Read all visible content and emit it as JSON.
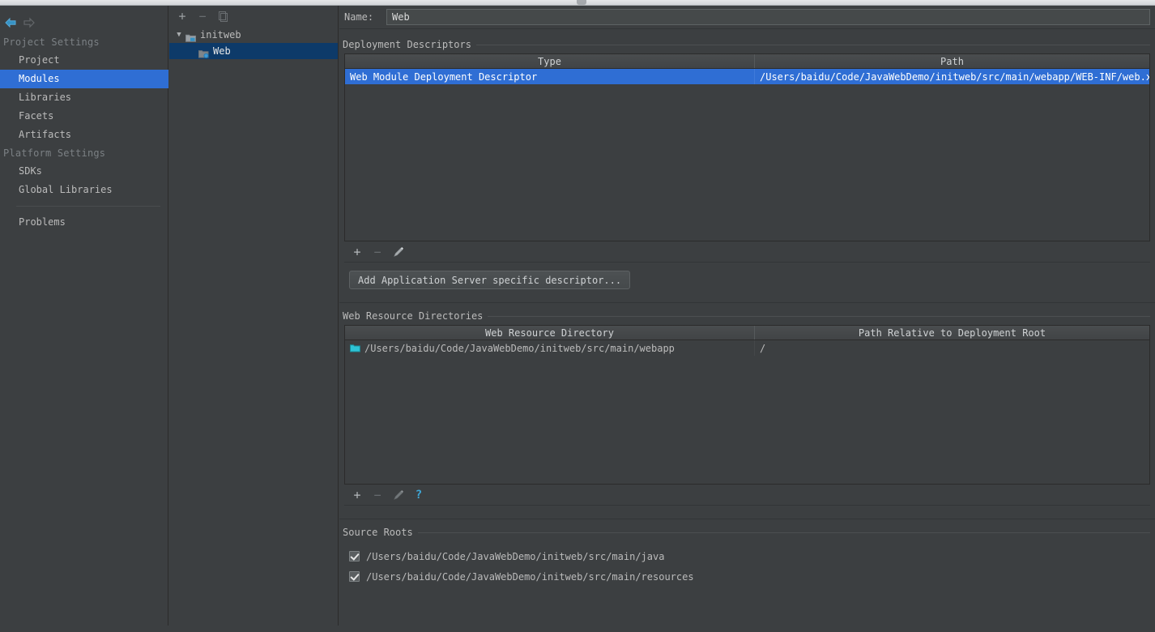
{
  "sidebar": {
    "nav": {
      "back_icon": "arrow-left-icon",
      "forward_icon": "arrow-right-icon"
    },
    "groups": [
      {
        "title": "Project Settings",
        "items": [
          {
            "label": "Project",
            "selected": false
          },
          {
            "label": "Modules",
            "selected": true
          },
          {
            "label": "Libraries",
            "selected": false
          },
          {
            "label": "Facets",
            "selected": false
          },
          {
            "label": "Artifacts",
            "selected": false
          }
        ]
      },
      {
        "title": "Platform Settings",
        "items": [
          {
            "label": "SDKs",
            "selected": false
          },
          {
            "label": "Global Libraries",
            "selected": false
          }
        ]
      }
    ],
    "problems": {
      "label": "Problems"
    }
  },
  "tree": {
    "toolbar": [
      {
        "icon": "plus-icon",
        "label": "+",
        "disabled": false
      },
      {
        "icon": "minus-icon",
        "label": "−",
        "disabled": true
      },
      {
        "icon": "copy-icon",
        "label": "⎘",
        "disabled": true
      }
    ],
    "nodes": [
      {
        "label": "initweb",
        "depth": 0,
        "expanded": true,
        "icon": "module-folder-icon",
        "selected": false
      },
      {
        "label": "Web",
        "depth": 1,
        "expanded": false,
        "icon": "web-facet-icon",
        "selected": true
      }
    ]
  },
  "detail": {
    "name": {
      "label": "Name:",
      "value": "Web",
      "placeholder": ""
    },
    "deployment_descriptors": {
      "title": "Deployment Descriptors",
      "columns": [
        "Type",
        "Path"
      ],
      "rows": [
        {
          "type": "Web Module Deployment Descriptor",
          "path": "/Users/baidu/Code/JavaWebDemo/initweb/src/main/webapp/WEB-INF/web.xml",
          "selected": true
        }
      ],
      "toolbar": [
        {
          "icon": "plus-icon",
          "label": "+",
          "disabled": false
        },
        {
          "icon": "minus-icon",
          "label": "−",
          "disabled": true
        },
        {
          "icon": "pencil-icon",
          "label": "✎",
          "disabled": false
        }
      ],
      "add_descriptor_button": "Add Application Server specific descriptor..."
    },
    "web_resource_directories": {
      "title": "Web Resource Directories",
      "columns": [
        "Web Resource Directory",
        "Path Relative to Deployment Root"
      ],
      "rows": [
        {
          "directory": "/Users/baidu/Code/JavaWebDemo/initweb/src/main/webapp",
          "relative_path": "/",
          "icon": "folder-icon",
          "selected": false
        }
      ],
      "toolbar": [
        {
          "icon": "plus-icon",
          "label": "+",
          "disabled": false
        },
        {
          "icon": "minus-icon",
          "label": "−",
          "disabled": true
        },
        {
          "icon": "pencil-icon",
          "label": "✎",
          "disabled": true
        },
        {
          "icon": "help-icon",
          "label": "?",
          "disabled": false
        }
      ]
    },
    "source_roots": {
      "title": "Source Roots",
      "items": [
        {
          "path": "/Users/baidu/Code/JavaWebDemo/initweb/src/main/java",
          "checked": true
        },
        {
          "path": "/Users/baidu/Code/JavaWebDemo/initweb/src/main/resources",
          "checked": true
        }
      ]
    }
  },
  "colors": {
    "background": "#3c3f41",
    "selection_blue": "#2f6ed4",
    "tree_selection": "#0d3a69",
    "accent_cyan": "#3592c4",
    "text": "#bbbbbb",
    "muted_text": "#7b8084"
  }
}
